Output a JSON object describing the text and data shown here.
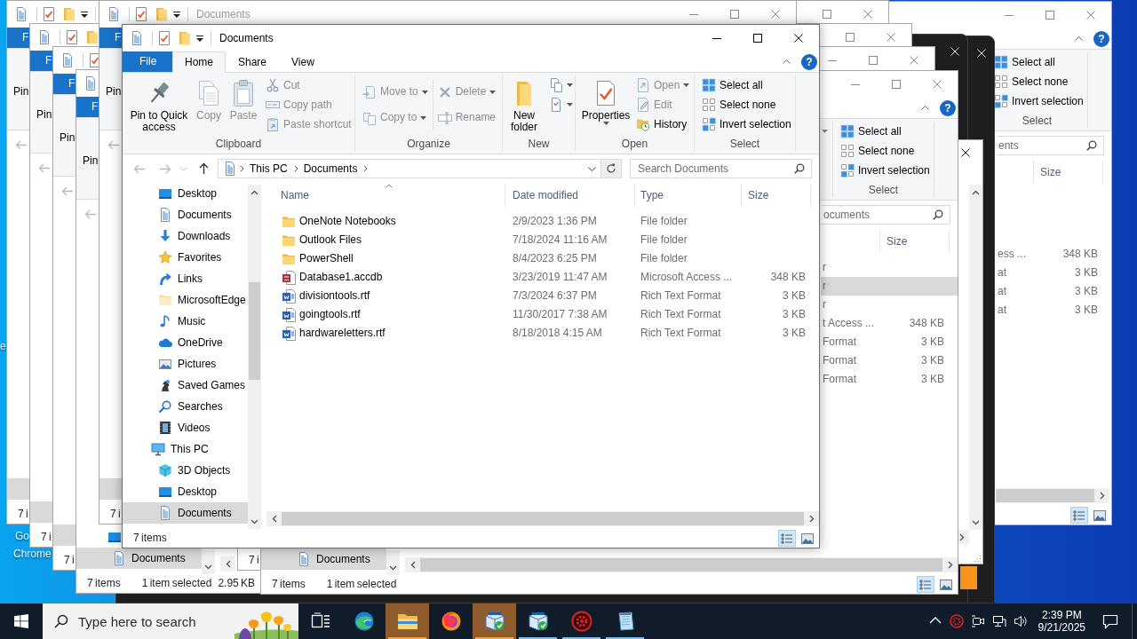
{
  "desktop": {
    "labels": [
      {
        "text": "e"
      },
      {
        "text": "Go"
      },
      {
        "text": "Chrome"
      }
    ]
  },
  "windows": [
    {
      "kind": "explorer",
      "tabs": [
        {
          "kind": "file",
          "label": "F",
          "selected": false
        }
      ],
      "ribbon": [
        {
          "kind": "clipboard",
          "items": [
            {
              "kind": "pin",
              "label": "Pin",
              "disabled": false
            }
          ]
        }
      ],
      "nav_buttons": [
        {
          "kind": "back",
          "disabled": true
        }
      ],
      "nav": [
        {
          "children": [
            {
              "selected": true
            }
          ]
        }
      ],
      "status": [
        "7 i"
      ]
    },
    {
      "kind": "explorer",
      "tabs": [
        {
          "kind": "file",
          "label": "F",
          "selected": false
        }
      ],
      "ribbon": [
        {
          "kind": "clipboard",
          "items": [
            {
              "kind": "pin",
              "label": "Pin",
              "disabled": false
            }
          ]
        }
      ],
      "nav_buttons": [
        {
          "kind": "back",
          "disabled": true
        }
      ],
      "nav": [
        {
          "children": [
            {
              "selected": true
            }
          ]
        }
      ],
      "status": [
        "7 i"
      ]
    },
    {
      "kind": "explorer",
      "tabs": [
        {
          "kind": "file",
          "label": "F",
          "selected": false
        }
      ],
      "ribbon": [
        {
          "kind": "clipboard",
          "items": [
            {
              "kind": "pin",
              "label": "Pin",
              "disabled": false
            }
          ]
        }
      ],
      "nav_buttons": [
        {
          "kind": "back",
          "disabled": true
        }
      ],
      "nav": [
        {
          "children": [
            {
              "selected": true
            }
          ]
        }
      ],
      "status": [
        "7 i"
      ]
    },
    {
      "kind": "explorer",
      "tabs": [
        {
          "kind": "file",
          "label": "F",
          "selected": false
        }
      ],
      "ribbon": [
        {
          "kind": "clipboard",
          "items": [
            {
              "kind": "pin",
              "label": "Pin",
              "disabled": false
            }
          ]
        }
      ],
      "nav_buttons": [
        {
          "kind": "back",
          "disabled": true
        }
      ],
      "nav": [
        {
          "children": [
            {
              "kind": "desktop",
              "selected": false
            },
            {
              "kind": "documents",
              "label": "Documents",
              "selected": true
            }
          ]
        }
      ],
      "status": [
        "7 items",
        "1 item selected",
        "2.95 KB"
      ]
    },
    {
      "kind": "explorer",
      "active": false,
      "title": "Documents",
      "tabs": [
        {
          "kind": "file",
          "label": "F",
          "selected": false
        }
      ],
      "ribbon": [
        {
          "kind": "clipboard",
          "items": [
            {
              "kind": "pin",
              "label": "Pin",
              "disabled": false
            }
          ]
        }
      ],
      "nav_buttons": [
        {
          "kind": "back",
          "disabled": true
        }
      ],
      "nav": [
        {
          "children": [
            {
              "selected": true
            }
          ]
        }
      ],
      "status": [
        "7 i"
      ]
    },
    {
      "kind": "dark"
    },
    {
      "kind": "explorer",
      "active": true,
      "title": "Documents",
      "tabs": [
        {
          "kind": "file",
          "label": "File",
          "selected": false
        },
        {
          "kind": "tab",
          "label": "Home",
          "selected": true
        },
        {
          "kind": "tab",
          "label": "Share",
          "selected": false
        },
        {
          "kind": "tab",
          "label": "View",
          "selected": false
        }
      ],
      "tab_tools": [
        {
          "kind": "collapse"
        },
        {
          "kind": "help",
          "label": "?"
        }
      ],
      "ribbon": [
        {
          "kind": "clipboard",
          "label": "Clipboard",
          "items": [
            {
              "kind": "pin",
              "label": "Pin to Quick access",
              "disabled": false
            },
            {
              "kind": "copy",
              "label": "Copy",
              "disabled": true
            },
            {
              "kind": "paste",
              "label": "Paste",
              "disabled": true
            },
            {
              "kind": "cut",
              "label": "Cut",
              "disabled": true
            },
            {
              "kind": "copy-path",
              "label": "Copy path",
              "disabled": true
            },
            {
              "kind": "paste-shortcut",
              "label": "Paste shortcut",
              "disabled": true
            }
          ]
        },
        {
          "kind": "organize",
          "label": "Organize",
          "items": [
            {
              "kind": "move-to",
              "label": "Move to",
              "disabled": true,
              "dropdown": true
            },
            {
              "kind": "copy-to",
              "label": "Copy to",
              "disabled": true,
              "dropdown": true
            },
            {
              "kind": "delete",
              "label": "Delete",
              "disabled": true,
              "dropdown": true
            },
            {
              "kind": "rename",
              "label": "Rename",
              "disabled": true
            }
          ]
        },
        {
          "kind": "new",
          "label": "New",
          "items": [
            {
              "kind": "new-folder",
              "label": "New folder",
              "disabled": false
            },
            {
              "kind": "new-item",
              "disabled": false,
              "dropdown": true
            },
            {
              "kind": "easy-access",
              "disabled": false,
              "dropdown": true
            }
          ]
        },
        {
          "kind": "open",
          "label": "Open",
          "items": [
            {
              "kind": "properties",
              "label": "Properties",
              "disabled": false,
              "dropdown": true
            },
            {
              "kind": "open",
              "label": "Open",
              "disabled": true,
              "dropdown": true
            },
            {
              "kind": "edit",
              "label": "Edit",
              "disabled": true
            },
            {
              "kind": "history",
              "label": "History",
              "disabled": false
            }
          ]
        },
        {
          "kind": "select",
          "label": "Select",
          "items": [
            {
              "kind": "select-all",
              "label": "Select all",
              "disabled": false
            },
            {
              "kind": "select-none",
              "label": "Select none",
              "disabled": false
            },
            {
              "kind": "invert-selection",
              "label": "Invert selection",
              "disabled": false
            }
          ]
        }
      ],
      "nav_buttons": [
        {
          "kind": "back",
          "disabled": true
        },
        {
          "kind": "forward",
          "disabled": true
        },
        {
          "kind": "recent",
          "disabled": true
        },
        {
          "kind": "up",
          "disabled": false
        }
      ],
      "address": {
        "crumbs": [
          "This PC",
          "Documents"
        ]
      },
      "search": {
        "placeholder": "Search Documents"
      },
      "nav": [
        {
          "children": [
            {
              "kind": "desktop",
              "label": "Desktop",
              "selected": false
            },
            {
              "kind": "documents",
              "label": "Documents",
              "selected": false
            },
            {
              "kind": "downloads",
              "label": "Downloads",
              "selected": false
            },
            {
              "kind": "favorites",
              "label": "Favorites",
              "selected": false
            },
            {
              "kind": "links",
              "label": "Links",
              "selected": false
            },
            {
              "kind": "folder-plain",
              "label": "MicrosoftEdge",
              "selected": false
            },
            {
              "kind": "music",
              "label": "Music",
              "selected": false
            },
            {
              "kind": "onedrive",
              "label": "OneDrive",
              "selected": false
            },
            {
              "kind": "pictures",
              "label": "Pictures",
              "selected": false
            },
            {
              "kind": "saved-games",
              "label": "Saved Games",
              "selected": false
            },
            {
              "kind": "searches",
              "label": "Searches",
              "selected": false
            },
            {
              "kind": "videos",
              "label": "Videos",
              "selected": false
            }
          ]
        },
        {
          "kind": "pc",
          "label": "This PC",
          "selected": false,
          "children": [
            {
              "kind": "objects-3d",
              "label": "3D Objects",
              "selected": false
            },
            {
              "kind": "desktop",
              "label": "Desktop",
              "selected": false
            },
            {
              "kind": "documents",
              "label": "Documents",
              "selected": true
            }
          ]
        }
      ],
      "columns": [
        {
          "kind": "name",
          "label": "Name",
          "sorted": true
        },
        {
          "kind": "date",
          "label": "Date modified",
          "sorted": false
        },
        {
          "kind": "type",
          "label": "Type",
          "sorted": false
        },
        {
          "kind": "size",
          "label": "Size",
          "sorted": false
        }
      ],
      "rows": [
        {
          "kind": "folder",
          "name": "OneNote Notebooks",
          "date": "2/9/2023 1:36 PM",
          "type": "File folder",
          "selected": false
        },
        {
          "kind": "folder",
          "name": "Outlook Files",
          "date": "7/18/2024 11:16 AM",
          "type": "File folder",
          "selected": false
        },
        {
          "kind": "folder",
          "name": "PowerShell",
          "date": "8/4/2023 6:25 PM",
          "type": "File folder",
          "selected": false
        },
        {
          "kind": "access",
          "name": "Database1.accdb",
          "date": "3/23/2019 11:47 AM",
          "type": "Microsoft Access ...",
          "size": "348 KB",
          "selected": false
        },
        {
          "kind": "rtf",
          "name": "divisiontools.rtf",
          "date": "7/3/2024 6:37 PM",
          "type": "Rich Text Format",
          "size": "3 KB",
          "selected": false
        },
        {
          "kind": "rtf",
          "name": "goingtools.rtf",
          "date": "11/30/2017 7:38 AM",
          "type": "Rich Text Format",
          "size": "3 KB",
          "selected": false
        },
        {
          "kind": "rtf",
          "name": "hardwareletters.rtf",
          "date": "8/18/2018 4:15 AM",
          "type": "Rich Text Format",
          "size": "3 KB",
          "selected": false
        }
      ],
      "status": [
        "7 items"
      ],
      "views": [
        {
          "kind": "details",
          "selected": true
        },
        {
          "kind": "large-icons",
          "selected": false
        }
      ]
    },
    {
      "kind": "dark"
    },
    {
      "kind": "explorer",
      "active": false
    },
    {
      "kind": "explorer",
      "active": false
    },
    {
      "kind": "explorer",
      "active": false,
      "status": [
        "7 i"
      ]
    },
    {
      "kind": "explorer",
      "active": false,
      "tab_tools": [
        {
          "kind": "collapse"
        },
        {
          "kind": "help",
          "label": "?"
        }
      ],
      "ribbon": [
        {
          "kind": "open",
          "items": [
            {
              "kind": "caret"
            }
          ]
        },
        {
          "kind": "select",
          "label": "Select",
          "items": [
            {
              "kind": "select-all",
              "label": "Select all",
              "disabled": false
            },
            {
              "kind": "select-none",
              "label": "Select none",
              "disabled": false
            },
            {
              "kind": "invert-selection",
              "label": "Invert selection",
              "disabled": false
            }
          ]
        }
      ],
      "search": {
        "placeholder": "ocuments"
      },
      "nav": [
        {
          "children": [
            {
              "kind": "documents",
              "label": "Documents",
              "selected": true
            }
          ]
        }
      ],
      "columns": [
        {
          "kind": "size",
          "label": "Size",
          "sorted": false
        }
      ],
      "rows": [
        {
          "type": "r",
          "selected": false
        },
        {
          "type": "r",
          "selected": true
        },
        {
          "type": "r",
          "selected": false
        },
        {
          "type": "t Access ...",
          "size": "348 KB",
          "selected": false
        },
        {
          "type": "Format",
          "size": "3 KB",
          "selected": false
        },
        {
          "type": "Format",
          "size": "3 KB",
          "selected": false
        },
        {
          "type": "Format",
          "size": "3 KB",
          "selected": false
        }
      ],
      "status": [
        "7 items",
        "1 item selected"
      ],
      "views": [
        {
          "kind": "details",
          "selected": true
        },
        {
          "kind": "large-icons",
          "selected": false
        }
      ]
    },
    {
      "kind": "explorer",
      "active": false,
      "tab_tools": [
        {
          "kind": "collapse"
        },
        {
          "kind": "help",
          "label": "?"
        }
      ],
      "ribbon": [
        {
          "kind": "select",
          "label": "Select",
          "items": [
            {
              "kind": "select-all",
              "label": "Select all",
              "disabled": false
            },
            {
              "kind": "select-none",
              "label": "Select none",
              "disabled": false
            },
            {
              "kind": "invert-selection",
              "label": "Invert selection",
              "disabled": false
            }
          ]
        }
      ],
      "search": {
        "placeholder": "ents"
      },
      "columns": [
        {
          "kind": "size",
          "label": "Size",
          "sorted": false
        }
      ],
      "rows": [
        {
          "type": "ess ...",
          "size": "348 KB",
          "selected": false
        },
        {
          "type": "at",
          "size": "3 KB",
          "selected": false
        },
        {
          "type": "at",
          "size": "3 KB",
          "selected": false
        },
        {
          "type": "at",
          "size": "3 KB",
          "selected": false
        }
      ],
      "views": [
        {
          "kind": "details",
          "selected": true
        },
        {
          "kind": "large-icons",
          "selected": false
        }
      ]
    },
    {
      "kind": "plain"
    },
    {
      "kind": "tile"
    }
  ],
  "taskbar": {
    "search": {
      "placeholder": "Type here to search"
    },
    "apps": [
      {
        "kind": "edge",
        "running": false,
        "flashing": false
      },
      {
        "kind": "explorer",
        "running": true,
        "flashing": true
      },
      {
        "kind": "firefox",
        "running": false,
        "flashing": false
      },
      {
        "kind": "package",
        "running": true,
        "flashing": true
      },
      {
        "kind": "package",
        "running": true,
        "flashing": false
      },
      {
        "kind": "gear-app",
        "running": true,
        "flashing": false
      },
      {
        "kind": "notepad",
        "running": true,
        "flashing": false
      }
    ],
    "clock": {
      "time": "2:39 PM",
      "date": "9/21/2025"
    }
  }
}
